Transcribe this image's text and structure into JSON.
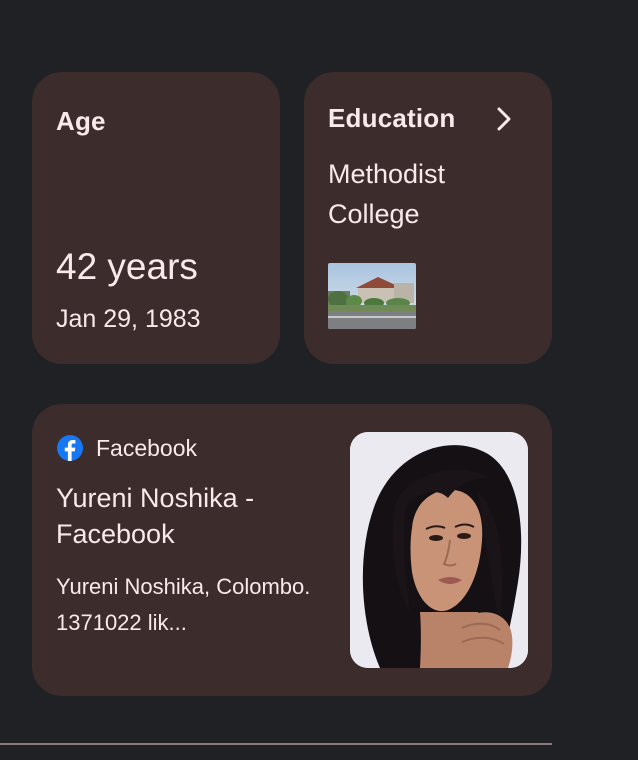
{
  "age_card": {
    "heading": "Age",
    "value": "42 years",
    "date": "Jan 29, 1983"
  },
  "education_card": {
    "heading": "Education",
    "value": "Methodist College",
    "icons": {
      "chevron": "chevron-right-icon",
      "thumbnail": "college-building-photo"
    }
  },
  "facebook_card": {
    "source": "Facebook",
    "title": "Yureni Noshika - Facebook",
    "snippet": "Yureni Noshika, Colombo. 1371022 lik...",
    "icons": {
      "source": "facebook-icon",
      "photo": "profile-photo"
    }
  },
  "colors": {
    "page_background": "#202124",
    "card_background": "#3c2c2c",
    "text": "#f8eaea",
    "facebook_blue": "#1877f2",
    "divider": "#8a7a7c"
  }
}
